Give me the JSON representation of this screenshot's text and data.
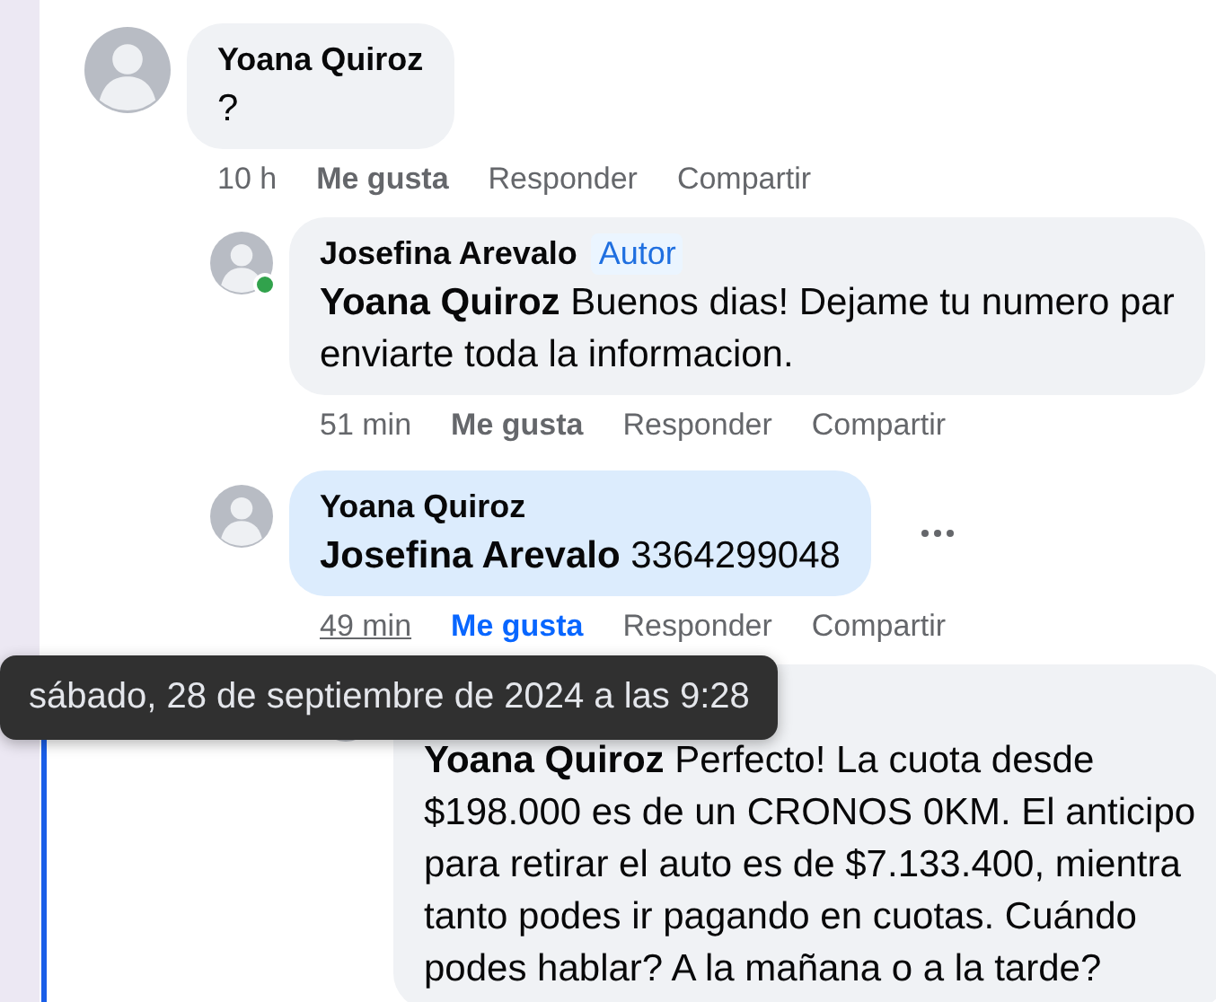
{
  "comments": [
    {
      "author": "Yoana Quiroz",
      "online": false,
      "lines": [
        "?"
      ],
      "time": "10 h",
      "time_hovered": false,
      "like": "Me gusta",
      "liked": false,
      "reply": "Responder",
      "share": "Compartir",
      "more_menu": false,
      "highlighted": false,
      "replies": [
        {
          "author": "Josefina Arevalo",
          "author_badge": "Autor",
          "online": true,
          "lines": [
            "**Yoana Quiroz** Buenos dias! Dejame tu numero par",
            "enviarte toda la informacion."
          ],
          "time": "51 min",
          "time_hovered": false,
          "like": "Me gusta",
          "liked": false,
          "reply": "Responder",
          "share": "Compartir",
          "more_menu": false,
          "highlighted": false
        },
        {
          "author": "Yoana Quiroz",
          "online": false,
          "lines": [
            "**Josefina Arevalo** 3364299048"
          ],
          "time": "49 min",
          "time_hovered": true,
          "like": "Me gusta",
          "liked": true,
          "reply": "Responder",
          "share": "Compartir",
          "more_menu": true,
          "highlighted": true,
          "replies": [
            {
              "lines": [
                "**Yoana Quiroz** Perfecto! La cuota desde",
                "$198.000 es de un CRONOS 0KM. El anticipo",
                "para retirar el auto es de $7.133.400, mientra",
                "tanto podes ir pagando en cuotas. Cuándo",
                "podes hablar? A la mañana o a la tarde?"
              ],
              "highlighted": false
            }
          ]
        }
      ]
    }
  ],
  "tooltip": {
    "text": "sábado, 28 de septiembre de 2024 a las 9:28"
  }
}
